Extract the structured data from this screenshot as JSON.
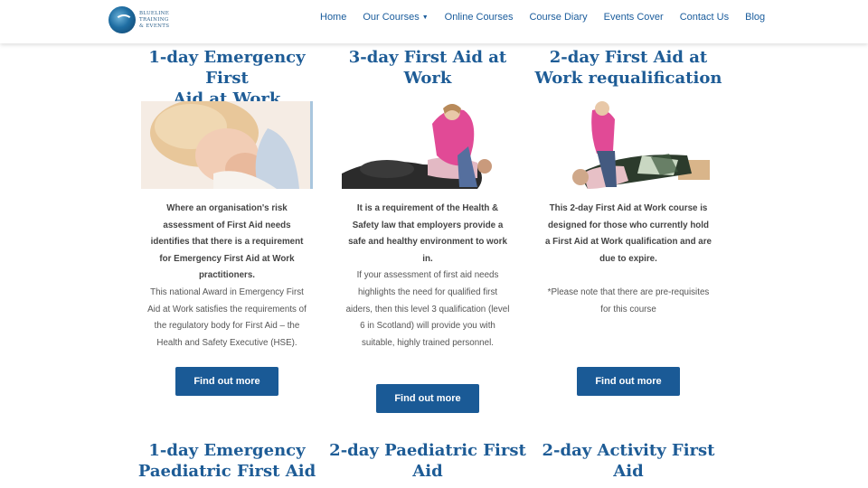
{
  "brand": {
    "line1": "BLUELINE",
    "line2": "TRAINING",
    "line3": "& EVENTS"
  },
  "nav": {
    "home": "Home",
    "our_courses": "Our Courses",
    "online_courses": "Online Courses",
    "course_diary": "Course Diary",
    "events_cover": "Events Cover",
    "contact_us": "Contact Us",
    "blog": "Blog"
  },
  "cards": [
    {
      "title_l1": "1-day Emergency First",
      "title_l2": "Aid at Work",
      "bold": [
        "Where an organisation's risk",
        "assessment of First Aid needs",
        "identifies that there is a requirement",
        "for Emergency First Aid at Work",
        "practitioners."
      ],
      "normal": [
        "This national Award in Emergency First",
        "Aid at Work satisfies the requirements of",
        "the regulatory body for First Aid – the",
        "Health and Safety Executive (HSE)."
      ],
      "button": "Find out more"
    },
    {
      "title_l1": "3-day First Aid at",
      "title_l2": "Work",
      "bold": [
        "It is a requirement of the Health &",
        "Safety law that employers provide a",
        "safe and healthy environment to work",
        "in."
      ],
      "normal": [
        "If your assessment of first aid needs",
        "highlights the need for qualified first",
        "aiders, then this level 3 qualification (level",
        "6 in Scotland) will provide you with",
        "suitable, highly trained personnel."
      ],
      "button": "Find out more"
    },
    {
      "title_l1": "2-day First Aid at",
      "title_l2": "Work requalification",
      "bold": [
        "This 2-day First Aid at Work course is",
        "designed for those who currently hold",
        "a First Aid at Work qualification and are",
        "due to expire."
      ],
      "normal": [
        "*Please note that there are pre-requisites",
        "for this course"
      ],
      "button": "Find out more"
    }
  ],
  "cards_row2": [
    {
      "title_l1": "1-day Emergency",
      "title_l2": "Paediatric First Aid"
    },
    {
      "title_l1": "2-day Paediatric First",
      "title_l2": "Aid"
    },
    {
      "title_l1": "2-day Activity First",
      "title_l2": "Aid"
    }
  ]
}
